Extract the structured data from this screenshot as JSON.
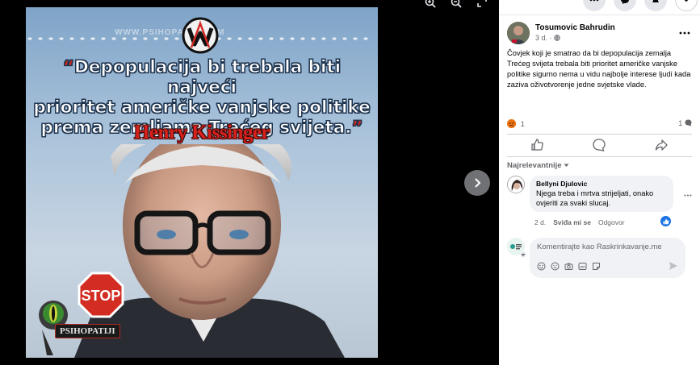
{
  "viewer": {
    "tools": [
      "zoom-in-icon",
      "zoom-out-icon",
      "fullscreen-icon"
    ],
    "image": {
      "watermark": "WWW.PSIHOPATIJI.COM",
      "quote": "Depopulacija bi trebala biti najveći prioritet američke vanjske politike prema zemljama Trećeg svijeta.",
      "quote_lines": [
        "Depopulacija bi trebala biti najveći",
        "prioritet američke vanjske politike",
        "prema zemljama Trećeg svijeta."
      ],
      "open_quote": "“",
      "close_quote": "”",
      "author": "Henry Kissinger",
      "stop_text": "STOP",
      "brand_text": "PSIHOPATIJI"
    },
    "next_icon": "chevron-right-icon"
  },
  "panel": {
    "author": "Tosumovic Bahrudin",
    "post_meta": "3 d. · ",
    "privacy_icon": "globe-icon",
    "post_text": "Čovjek koji je smatrao da bi depopulacija zemalja Trećeg svijeta trebala biti prioritet američke vanjske politike sigurno nema u vidu najbolje interese ljudi kada zaziva oživotvorenje jedne svjetske vlade.",
    "reaction_count": "1",
    "comment_count": "1",
    "sort_label": "Najrelevantnije",
    "comment": {
      "name": "Bellyni Djulovic",
      "text": "Njega treba i mrtva strijeljati, onako ovjeriti za svaki slucaj.",
      "age": "2 d.",
      "like_label": "Sviđa mi se",
      "reply_label": "Odgovor"
    },
    "composer": {
      "placeholder": "Komentirajte kao Raskrinkavanje.me"
    }
  },
  "colors": {
    "accent": "#1b74e4",
    "quote_red": "#d8211c",
    "panel_bg": "#ffffff",
    "bubble_bg": "#f0f2f5"
  }
}
